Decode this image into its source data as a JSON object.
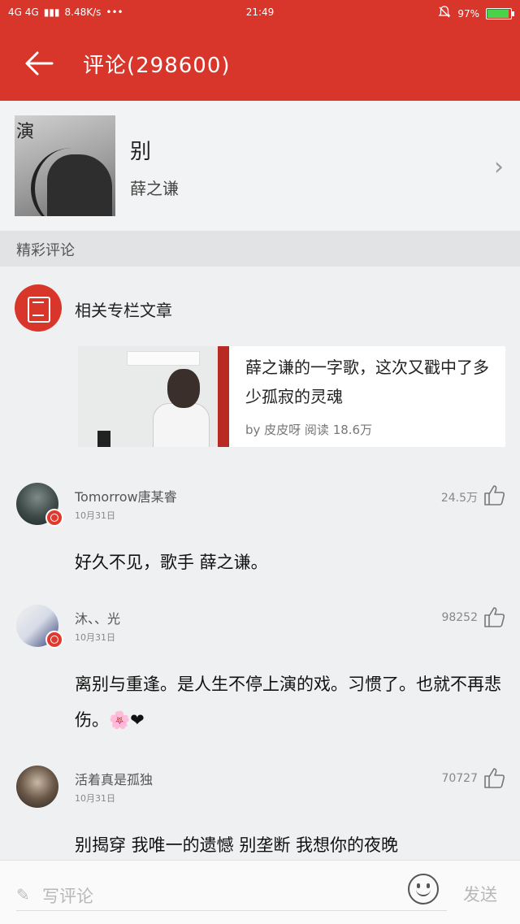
{
  "status_bar": {
    "network": "4G 4G",
    "speed": "8.48K/s",
    "more": "•••",
    "time": "21:49",
    "battery_percent": "97%",
    "battery_level": 0.97
  },
  "top_bar": {
    "title": "评论(298600)"
  },
  "song": {
    "cover_text": "演",
    "name": "别",
    "artist": "薛之谦"
  },
  "section": {
    "label": "精彩评论"
  },
  "related": {
    "label": "相关专栏文章",
    "article": {
      "title": "薛之谦的一字歌，这次又戳中了多少孤寂的灵魂",
      "meta": "by 皮皮呀   阅读 18.6万"
    }
  },
  "comments": [
    {
      "user": "Tomorrow唐某睿",
      "date": "10月31日",
      "likes": "24.5万",
      "text": "好久不见，歌手 薛之谦。"
    },
    {
      "user": "沐、、光",
      "date": "10月31日",
      "likes": "98252",
      "text": "离别与重逢。是人生不停上演的戏。习惯了。也就不再悲伤。🌸❤"
    },
    {
      "user": "活着真是孤独",
      "date": "10月31日",
      "likes": "70727",
      "text": "别揭穿 我唯一的遗憾 别垄断 我想你的夜晚"
    }
  ],
  "bottom_bar": {
    "placeholder": "写评论",
    "send_label": "发送"
  },
  "colors": {
    "accent": "#d8352b"
  }
}
